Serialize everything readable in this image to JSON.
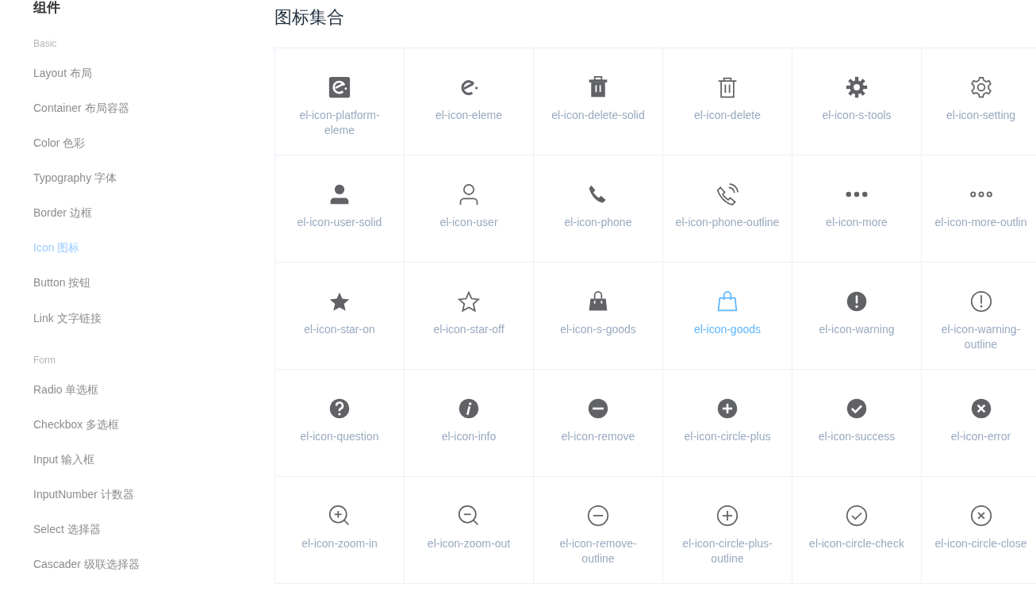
{
  "sidebar": {
    "heading": "组件",
    "groups": [
      {
        "title": "Basic",
        "items": [
          {
            "label": "Layout 布局",
            "selected": false
          },
          {
            "label": "Container 布局容器",
            "selected": false
          },
          {
            "label": "Color 色彩",
            "selected": false
          },
          {
            "label": "Typography 字体",
            "selected": false
          },
          {
            "label": "Border 边框",
            "selected": false
          },
          {
            "label": "Icon 图标",
            "selected": true
          },
          {
            "label": "Button 按钮",
            "selected": false
          },
          {
            "label": "Link 文字链接",
            "selected": false
          }
        ]
      },
      {
        "title": "Form",
        "items": [
          {
            "label": "Radio 单选框",
            "selected": false
          },
          {
            "label": "Checkbox 多选框",
            "selected": false
          },
          {
            "label": "Input 输入框",
            "selected": false
          },
          {
            "label": "InputNumber 计数器",
            "selected": false
          },
          {
            "label": "Select 选择器",
            "selected": false
          },
          {
            "label": "Cascader 级联选择器",
            "selected": false
          }
        ]
      }
    ]
  },
  "main": {
    "title": "图标集合",
    "icons": [
      {
        "label": "el-icon-platform-eleme",
        "selected": false
      },
      {
        "label": "el-icon-eleme",
        "selected": false
      },
      {
        "label": "el-icon-delete-solid",
        "selected": false
      },
      {
        "label": "el-icon-delete",
        "selected": false
      },
      {
        "label": "el-icon-s-tools",
        "selected": false
      },
      {
        "label": "el-icon-setting",
        "selected": false
      },
      {
        "label": "el-icon-user-solid",
        "selected": false
      },
      {
        "label": "el-icon-user",
        "selected": false
      },
      {
        "label": "el-icon-phone",
        "selected": false
      },
      {
        "label": "el-icon-phone-outline",
        "selected": false
      },
      {
        "label": "el-icon-more",
        "selected": false
      },
      {
        "label": "el-icon-more-outlin",
        "selected": false
      },
      {
        "label": "el-icon-star-on",
        "selected": false
      },
      {
        "label": "el-icon-star-off",
        "selected": false
      },
      {
        "label": "el-icon-s-goods",
        "selected": false
      },
      {
        "label": "el-icon-goods",
        "selected": true
      },
      {
        "label": "el-icon-warning",
        "selected": false
      },
      {
        "label": "el-icon-warning-outline",
        "selected": false
      },
      {
        "label": "el-icon-question",
        "selected": false
      },
      {
        "label": "el-icon-info",
        "selected": false
      },
      {
        "label": "el-icon-remove",
        "selected": false
      },
      {
        "label": "el-icon-circle-plus",
        "selected": false
      },
      {
        "label": "el-icon-success",
        "selected": false
      },
      {
        "label": "el-icon-error",
        "selected": false
      },
      {
        "label": "el-icon-zoom-in",
        "selected": false
      },
      {
        "label": "el-icon-zoom-out",
        "selected": false
      },
      {
        "label": "el-icon-remove-outline",
        "selected": false
      },
      {
        "label": "el-icon-circle-plus-outline",
        "selected": false
      },
      {
        "label": "el-icon-circle-check",
        "selected": false
      },
      {
        "label": "el-icon-circle-close",
        "selected": false
      }
    ]
  }
}
